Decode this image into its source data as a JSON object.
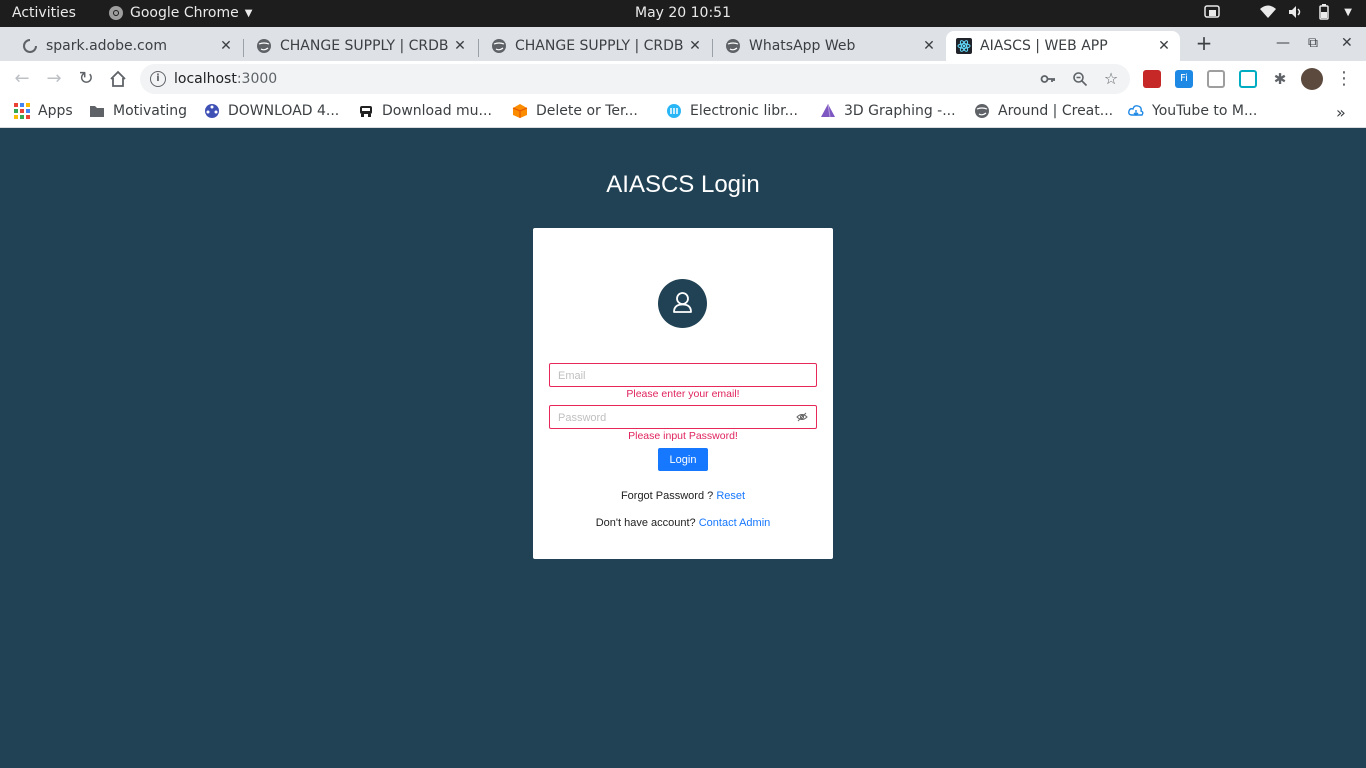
{
  "system": {
    "activities": "Activities",
    "app_name": "Google Chrome",
    "clock": "May 20  10:51"
  },
  "tabs": [
    {
      "title": "spark.adobe.com",
      "icon": "loading-spinner-icon",
      "active": false
    },
    {
      "title": "CHANGE SUPPLY | CRDB",
      "icon": "globe-icon",
      "active": false
    },
    {
      "title": "CHANGE SUPPLY | CRDB",
      "icon": "globe-icon",
      "active": false
    },
    {
      "title": "WhatsApp Web",
      "icon": "globe-icon",
      "active": false
    },
    {
      "title": "AIASCS | WEB APP",
      "icon": "react-icon",
      "active": true
    }
  ],
  "address_bar": {
    "host": "localhost",
    "port": ":3000"
  },
  "bookmarks": [
    {
      "label": "Apps",
      "icon": "apps-grid-icon"
    },
    {
      "label": "Motivating",
      "icon": "folder-icon"
    },
    {
      "label": "DOWNLOAD 4...",
      "icon": "film-reel-icon"
    },
    {
      "label": "Download mu...",
      "icon": "car-icon"
    },
    {
      "label": "Delete or Ter...",
      "icon": "cube-icon"
    },
    {
      "label": "Electronic libr...",
      "icon": "library-icon"
    },
    {
      "label": "3D Graphing -...",
      "icon": "prism-icon"
    },
    {
      "label": "Around | Creat...",
      "icon": "globe-icon"
    },
    {
      "label": "YouTube to M...",
      "icon": "cloud-download-icon"
    }
  ],
  "page": {
    "title": "AIASCS Login",
    "email_placeholder": "Email",
    "email_error": "Please enter your email!",
    "password_placeholder": "Password",
    "password_error": "Please input Password!",
    "login_label": "Login",
    "forgot_text": "Forgot Password ? ",
    "reset_link": "Reset",
    "no_account_text": "Don't have account? ",
    "contact_link": "Contact Admin"
  },
  "colors": {
    "page_bg": "#204254",
    "error": "#e0245e",
    "primary": "#1677ff"
  }
}
